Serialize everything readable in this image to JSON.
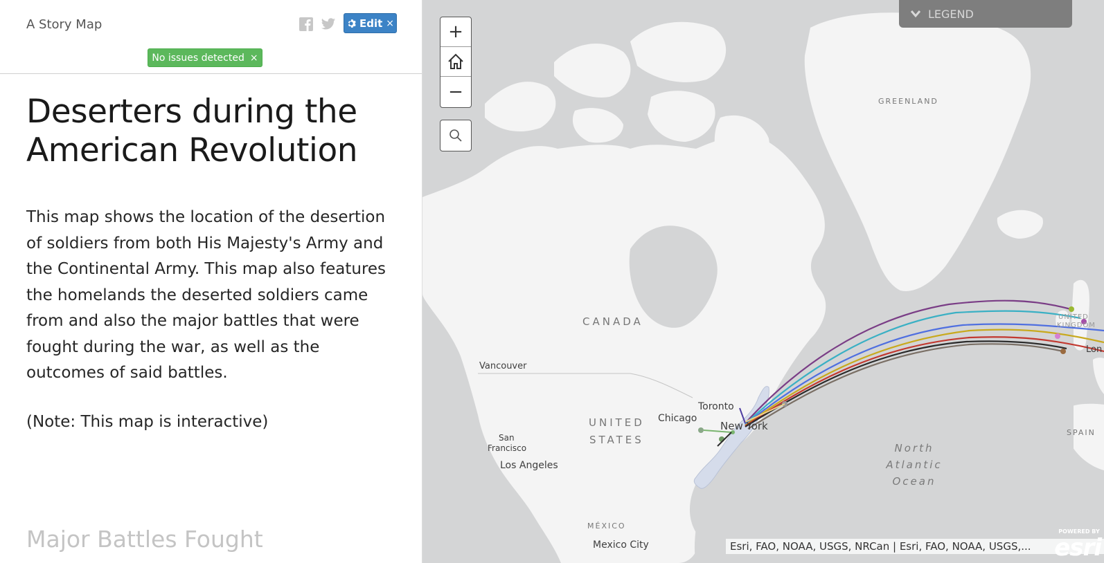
{
  "header": {
    "brand": "A Story Map",
    "edit_label": "Edit",
    "edit_close": "×",
    "issues_label": "No issues detected",
    "issues_close": "×"
  },
  "story": {
    "title": "Deserters during the American Revolution",
    "body": "This map shows the location of the desertion of soldiers from both His Majesty's Army and the Continental Army. This map also features the homelands the deserted soldiers came from and also the major battles that were fought during the war, as well as the outcomes of said battles.",
    "note": "(Note: This map is interactive)",
    "next_section": "Major Battles Fought"
  },
  "map": {
    "zoom_in": "+",
    "zoom_out": "−",
    "legend_label": "LEGEND",
    "labels": {
      "greenland": "GREENLAND",
      "canada": "CANADA",
      "united_states": "UNITED STATES",
      "united_states_line2": "STATES",
      "united": "UNITED",
      "kingdom": "KINGDOM",
      "mexico": "MÉXICO",
      "spain": "SPAIN",
      "ocean_line1": "North",
      "ocean_line2": "Atlantic",
      "ocean_line3": "Ocean",
      "vancouver": "Vancouver",
      "toronto": "Toronto",
      "chicago": "Chicago",
      "new_york": "New York",
      "san_francisco_1": "San",
      "san_francisco_2": "Francisco",
      "los_angeles": "Los Angeles",
      "mexico_city": "Mexico City",
      "london": "Lon"
    },
    "attribution": "Esri, FAO, NOAA, USGS, NRCan | Esri, FAO, NOAA, USGS,...",
    "esri_logo": "esri",
    "esri_powered": "POWERED BY",
    "colors": {
      "water": "#d4d5d6",
      "land": "#f5f5f5",
      "highlight": "#d5dceb",
      "panel_button": "#3c83c6",
      "success": "#5cb85c"
    }
  }
}
